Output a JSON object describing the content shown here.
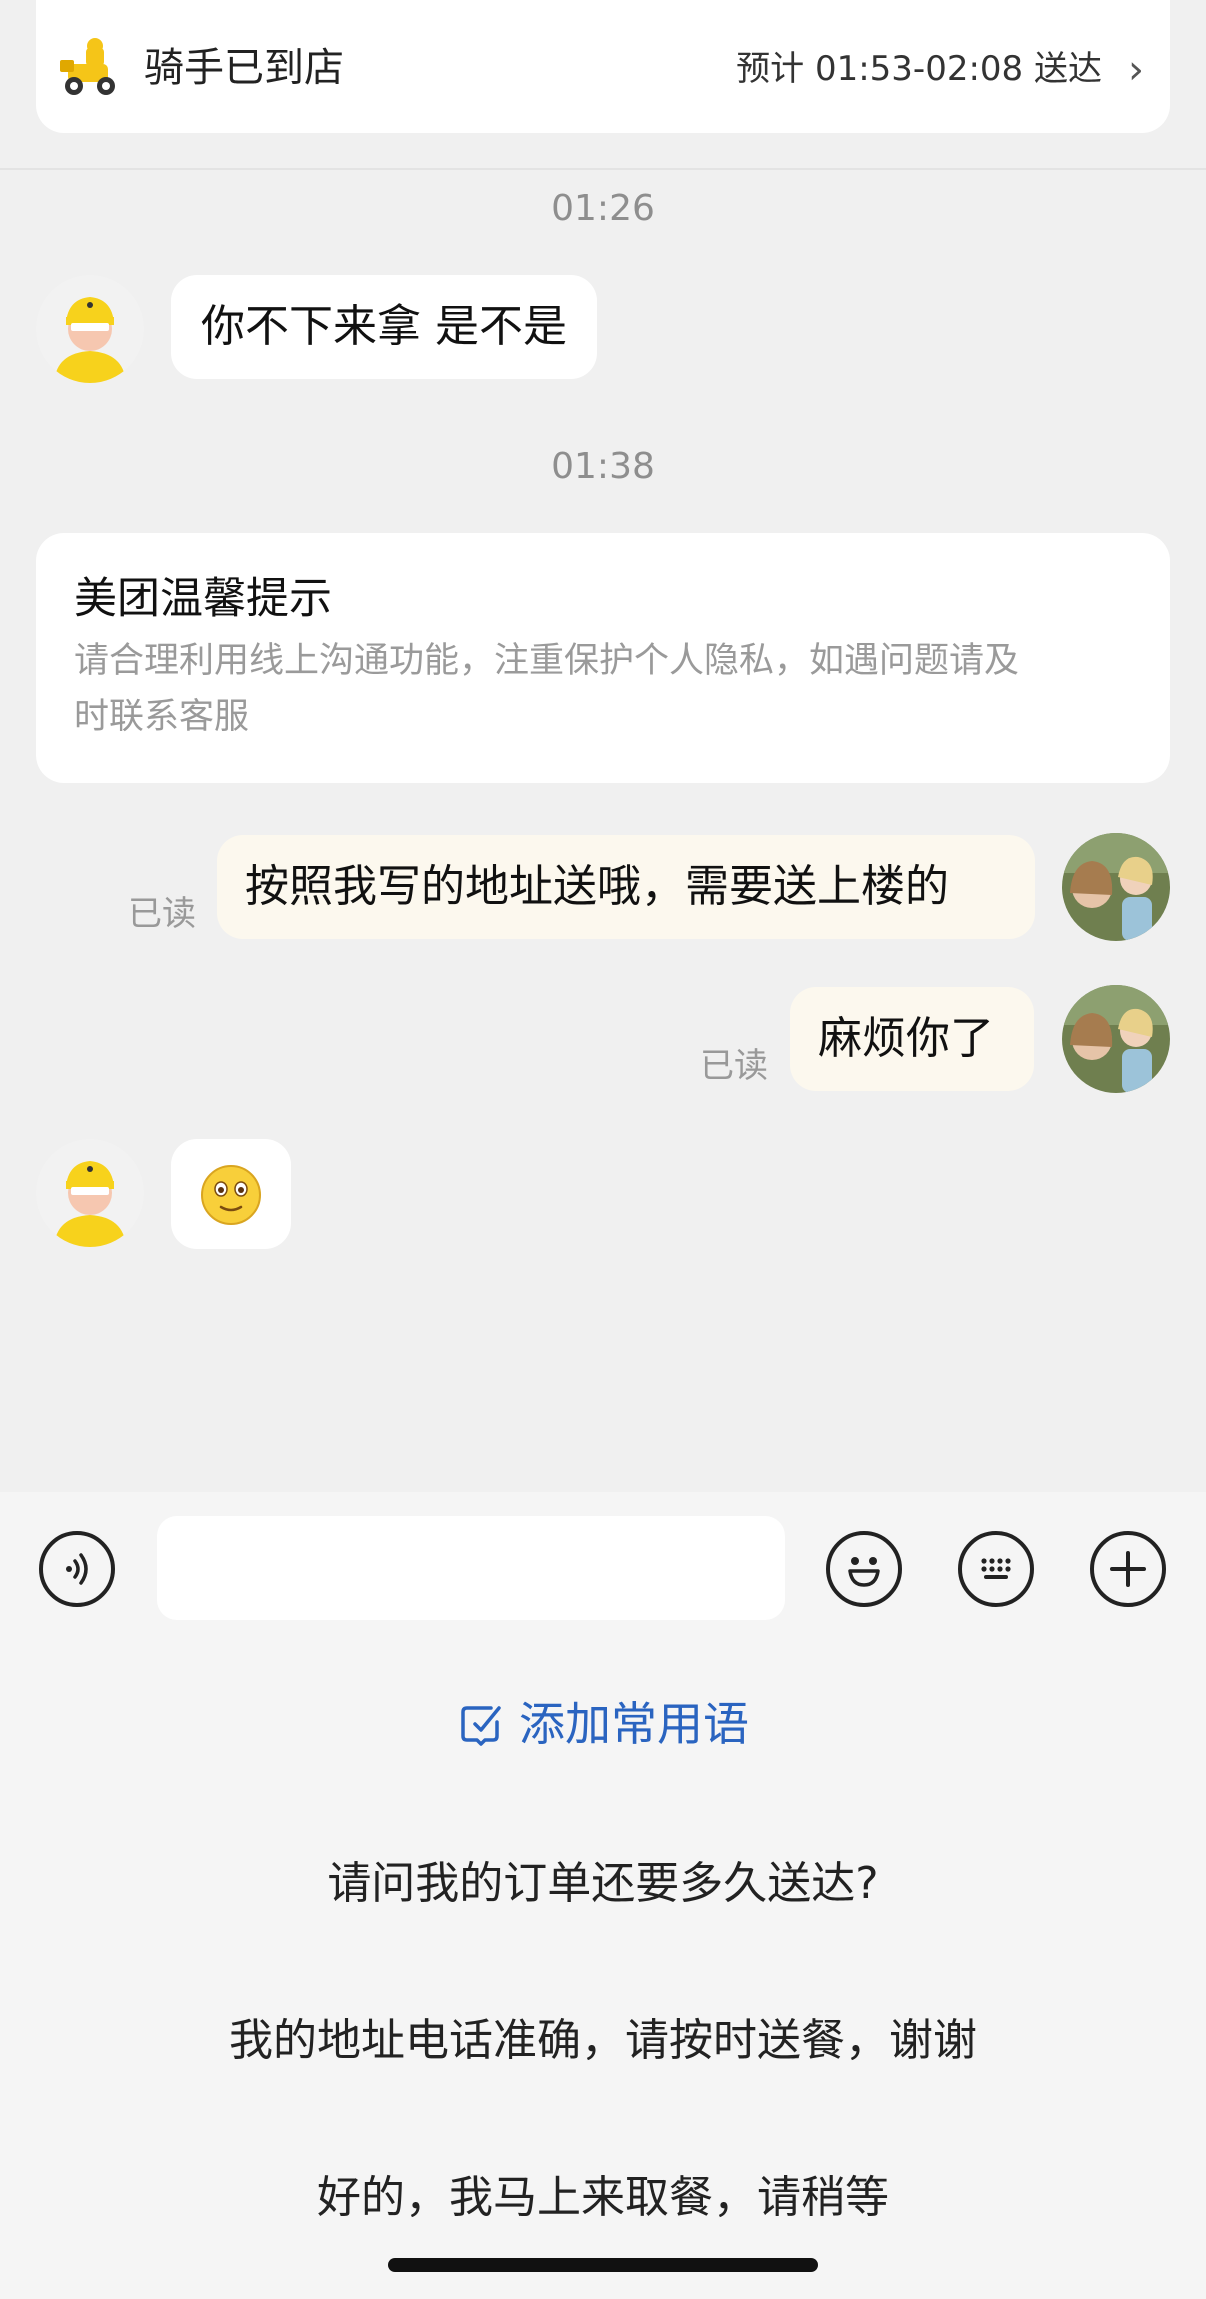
{
  "status": {
    "title": "骑手已到店",
    "eta": "预计 01:53-02:08 送达",
    "chevron": "›"
  },
  "messages": {
    "ts1": "01:26",
    "rider_msg1": "你不下来拿 是不是",
    "ts2": "01:38",
    "tip_title": "美团温馨提示",
    "tip_body_line1": "请合理利用线上沟通功能，注重保护个人隐私，如遇问题请及",
    "tip_body_line2": "时联系客服",
    "my_msg1": "按照我写的地址送哦，需要送上楼的",
    "my_msg1_status": "已读",
    "my_msg2": "麻烦你了",
    "my_msg2_status": "已读"
  },
  "input": {
    "placeholder": "",
    "add_phrase": "添加常用语"
  },
  "phrases": [
    "请问我的订单还要多久送达?",
    "我的地址电话准确，请按时送餐，谢谢",
    "好的，我马上来取餐，请稍等"
  ],
  "icons": {
    "rider_scooter": "scooter-icon",
    "voice": "voice-icon",
    "emoji": "emoji-icon",
    "keyboard": "keyboard-icon",
    "plus": "plus-icon",
    "edit": "edit-icon"
  },
  "colors": {
    "accent_blue": "#2a64c0",
    "my_bubble": "#fcf8ee",
    "rider_yellow": "#f7d21c"
  }
}
